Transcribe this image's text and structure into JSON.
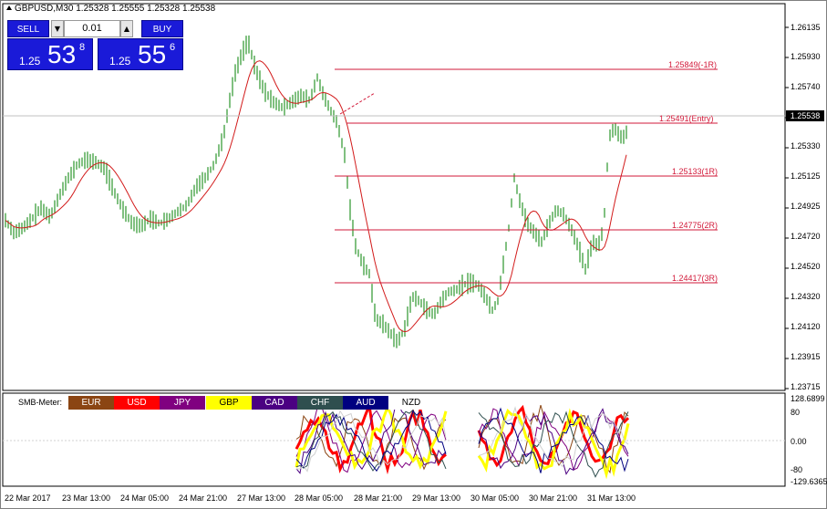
{
  "symbol_title": "GBPUSD,M30  1.25328 1.25555 1.25328 1.25538",
  "trade_panel": {
    "sell_label": "SELL",
    "buy_label": "BUY",
    "lot_value": "0.01",
    "dec_symbol": "▼",
    "inc_symbol": "▲",
    "sell_price": {
      "prefix": "1.25",
      "big": "53",
      "sup": "8"
    },
    "buy_price": {
      "prefix": "1.25",
      "big": "55",
      "sup": "6"
    }
  },
  "price_axis": [
    "1.26135",
    "1.25930",
    "1.25740",
    "1.25538",
    "1.25330",
    "1.25125",
    "1.24925",
    "1.24720",
    "1.24520",
    "1.24320",
    "1.24120",
    "1.23915",
    "1.23715"
  ],
  "current_price": "1.25538",
  "levels": [
    {
      "label": "1.25849(-1R)"
    },
    {
      "label": "1.25491(Entry)"
    },
    {
      "label": "1.25133(1R)"
    },
    {
      "label": "1.24775(2R)"
    },
    {
      "label": "1.24417(3R)"
    }
  ],
  "time_axis": [
    "22 Mar 2017",
    "23 Mar 13:00",
    "24 Mar 05:00",
    "24 Mar 21:00",
    "27 Mar 13:00",
    "28 Mar 05:00",
    "28 Mar 21:00",
    "29 Mar 13:00",
    "30 Mar 05:00",
    "30 Mar 21:00",
    "31 Mar 13:00"
  ],
  "indicator": {
    "name": "SMB-Meter:",
    "currencies": [
      {
        "label": "EUR",
        "color": "#8b4513"
      },
      {
        "label": "USD",
        "color": "#ff0000"
      },
      {
        "label": "JPY",
        "color": "#800080"
      },
      {
        "label": "GBP",
        "color": "#ffff00"
      },
      {
        "label": "CAD",
        "color": "#4b0082"
      },
      {
        "label": "CHF",
        "color": "#2f4f4f"
      },
      {
        "label": "AUD",
        "color": "#000080"
      },
      {
        "label": "NZD",
        "color": "#ffffff"
      }
    ],
    "axis": [
      "128.6899",
      "80",
      "0.00",
      "-80",
      "-129.6365"
    ]
  },
  "colors": {
    "candle": "#008000",
    "ma": "#d21a1a",
    "level": "#d21a3a",
    "panel_blue": "#1a1ad8"
  }
}
